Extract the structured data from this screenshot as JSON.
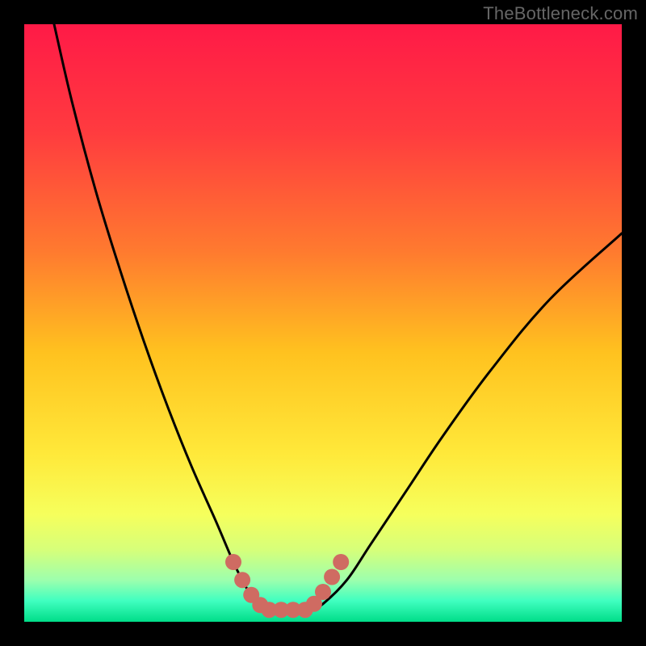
{
  "watermark": "TheBottleneck.com",
  "colors": {
    "frame": "#000000",
    "curve": "#000000",
    "markers": "#cf6b62",
    "gradient_stops": [
      {
        "offset": 0.0,
        "color": "#ff1a47"
      },
      {
        "offset": 0.18,
        "color": "#ff3b3f"
      },
      {
        "offset": 0.38,
        "color": "#ff7a2f"
      },
      {
        "offset": 0.55,
        "color": "#ffc21f"
      },
      {
        "offset": 0.72,
        "color": "#ffe93a"
      },
      {
        "offset": 0.82,
        "color": "#f6ff5c"
      },
      {
        "offset": 0.88,
        "color": "#d6ff7a"
      },
      {
        "offset": 0.93,
        "color": "#9dffad"
      },
      {
        "offset": 0.965,
        "color": "#40ffc0"
      },
      {
        "offset": 1.0,
        "color": "#00dd88"
      }
    ]
  },
  "chart_data": {
    "type": "line",
    "title": "",
    "xlabel": "",
    "ylabel": "",
    "xlim": [
      0,
      100
    ],
    "ylim": [
      0,
      100
    ],
    "series": [
      {
        "name": "left-branch",
        "note": "Steep descending branch from top-left toward the valley near x≈40",
        "x": [
          5,
          8,
          12,
          16,
          20,
          24,
          28,
          32,
          35,
          37,
          39,
          40
        ],
        "y": [
          100,
          87,
          72,
          59,
          47,
          36,
          26,
          17,
          10,
          6,
          3,
          2
        ]
      },
      {
        "name": "right-branch",
        "note": "Shallower ascending branch from valley near x≈48 up to right edge at ~65% height",
        "x": [
          48,
          50,
          54,
          58,
          64,
          70,
          78,
          88,
          100
        ],
        "y": [
          2,
          3,
          7,
          13,
          22,
          31,
          42,
          54,
          65
        ]
      },
      {
        "name": "valley-floor",
        "note": "Flat minimum segment between the two branches",
        "x": [
          40,
          44,
          48
        ],
        "y": [
          2,
          2,
          2
        ]
      }
    ],
    "markers": {
      "name": "highlighted-points",
      "color": "#cf6b62",
      "note": "Clustered dots along both flanks near the valley bottom",
      "points": [
        {
          "x": 35,
          "y": 10
        },
        {
          "x": 36.5,
          "y": 7
        },
        {
          "x": 38,
          "y": 4.5
        },
        {
          "x": 39.5,
          "y": 2.8
        },
        {
          "x": 41,
          "y": 2
        },
        {
          "x": 43,
          "y": 2
        },
        {
          "x": 45,
          "y": 2
        },
        {
          "x": 47,
          "y": 2
        },
        {
          "x": 48.5,
          "y": 3
        },
        {
          "x": 50,
          "y": 5
        },
        {
          "x": 51.5,
          "y": 7.5
        },
        {
          "x": 53,
          "y": 10
        }
      ]
    }
  }
}
